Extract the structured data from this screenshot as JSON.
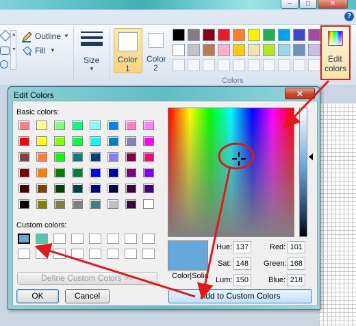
{
  "ribbon": {
    "outline_label": "Outline",
    "fill_label": "Fill",
    "size_label": "Size",
    "color1_label": [
      "Color",
      "1"
    ],
    "color2_label": [
      "Color",
      "2"
    ],
    "colors_group_label": "Colors",
    "edit_colors_label": [
      "Edit",
      "colors"
    ],
    "palette_row1": [
      "#000000",
      "#7f7f7f",
      "#880015",
      "#ed1c24",
      "#ff7f27",
      "#fff200",
      "#22b14c",
      "#00a2e8",
      "#3f48cc",
      "#a349a4"
    ],
    "palette_row2": [
      "#ffffff",
      "#c3c3c3",
      "#b97a57",
      "#ffaec9",
      "#ffc90e",
      "#efe4b0",
      "#b5e61d",
      "#99d9ea",
      "#7092be",
      "#c8bfe7"
    ]
  },
  "dialog": {
    "title": "Edit Colors",
    "close_symbol": "✕",
    "basic_colors_label": "Basic colors:",
    "basic_colors": [
      [
        "#ff8080",
        "#ffff80",
        "#80ff80",
        "#00ff80",
        "#80ffff",
        "#0080ff",
        "#ff80c0",
        "#ff80ff"
      ],
      [
        "#ff0000",
        "#ffff00",
        "#80ff00",
        "#00ff40",
        "#00ffff",
        "#0080c0",
        "#8080c0",
        "#ff00ff"
      ],
      [
        "#804040",
        "#ff8040",
        "#00ff00",
        "#008080",
        "#004080",
        "#8080ff",
        "#800040",
        "#ff0080"
      ],
      [
        "#800000",
        "#ff8000",
        "#008000",
        "#008040",
        "#0000ff",
        "#0000a0",
        "#800080",
        "#8000ff"
      ],
      [
        "#400000",
        "#804000",
        "#004000",
        "#004040",
        "#000080",
        "#000040",
        "#400040",
        "#400080"
      ],
      [
        "#000000",
        "#808000",
        "#808040",
        "#808080",
        "#408080",
        "#c0c0c0",
        "#400040",
        "#ffffff"
      ]
    ],
    "custom_colors_label": "Custom colors:",
    "custom_colors": [
      "#65a8da",
      "#4cc7b0",
      "#ffffff",
      "#ffffff",
      "#ffffff",
      "#ffffff",
      "#ffffff",
      "#ffffff",
      "#ffffff",
      "#ffffff",
      "#ffffff",
      "#ffffff",
      "#ffffff",
      "#ffffff",
      "#ffffff",
      "#ffffff"
    ],
    "define_button": "Define Custom Colors >>",
    "ok_button": "OK",
    "cancel_button": "Cancel",
    "color_solid_label": "Color|Solid",
    "add_button": "Add to Custom Colors",
    "preview_color": "#65a8da",
    "hue_label": "Hue:",
    "hue": "137",
    "sat_label": "Sat:",
    "sat": "148",
    "lum_label": "Lum:",
    "lum": "150",
    "red_label": "Red:",
    "red": "101",
    "green_label": "Green:",
    "green": "168",
    "blue_label": "Blue:",
    "blue": "218"
  }
}
